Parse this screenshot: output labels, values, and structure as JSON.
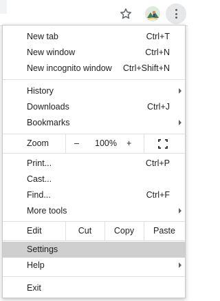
{
  "toolbar": {
    "star_icon": "star-outline-icon",
    "avatar_icon": "profile-avatar-icon",
    "menu_icon": "more-vertical-icon"
  },
  "menu": {
    "new_tab": {
      "label": "New tab",
      "shortcut": "Ctrl+T"
    },
    "new_window": {
      "label": "New window",
      "shortcut": "Ctrl+N"
    },
    "new_incognito": {
      "label": "New incognito window",
      "shortcut": "Ctrl+Shift+N"
    },
    "history": {
      "label": "History"
    },
    "downloads": {
      "label": "Downloads",
      "shortcut": "Ctrl+J"
    },
    "bookmarks": {
      "label": "Bookmarks"
    },
    "zoom": {
      "label": "Zoom",
      "minus": "–",
      "value": "100%",
      "plus": "+"
    },
    "print": {
      "label": "Print...",
      "shortcut": "Ctrl+P"
    },
    "cast": {
      "label": "Cast..."
    },
    "find": {
      "label": "Find...",
      "shortcut": "Ctrl+F"
    },
    "more_tools": {
      "label": "More tools"
    },
    "edit": {
      "label": "Edit",
      "cut": "Cut",
      "copy": "Copy",
      "paste": "Paste"
    },
    "settings": {
      "label": "Settings"
    },
    "help": {
      "label": "Help"
    },
    "exit": {
      "label": "Exit"
    }
  },
  "colors": {
    "highlight": "#cfcfcf",
    "separator": "#e0e0e0",
    "text": "#202124",
    "icon": "#5f6368"
  }
}
